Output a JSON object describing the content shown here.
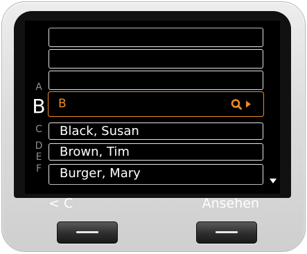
{
  "index_letters": {
    "above": "A",
    "current": "B",
    "below": [
      "C",
      "D",
      "E",
      "F"
    ]
  },
  "search_row": {
    "value": "B",
    "icon": "search-icon"
  },
  "contacts": [
    {
      "name": "Black, Susan"
    },
    {
      "name": "Brown, Tim"
    },
    {
      "name": "Burger, Mary"
    }
  ],
  "softkeys": {
    "left": "< C",
    "right": "Ansehen"
  },
  "colors": {
    "accent": "#f08a24",
    "screen_bg": "#000000",
    "text": "#ffffff",
    "letter_dim": "#8f8f8f"
  }
}
